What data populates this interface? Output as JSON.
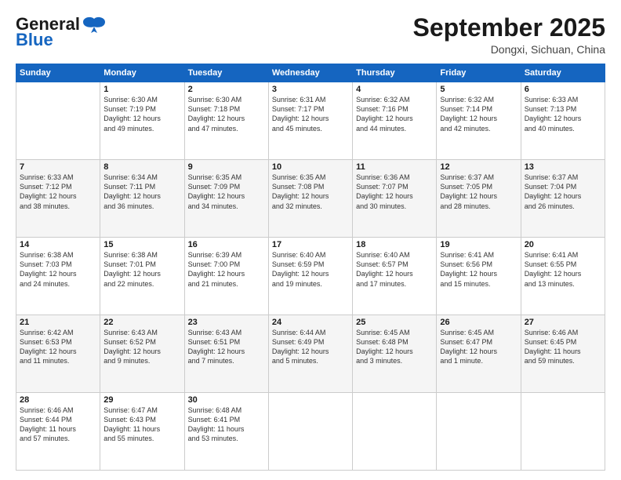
{
  "header": {
    "logo_general": "General",
    "logo_blue": "Blue",
    "month_title": "September 2025",
    "location": "Dongxi, Sichuan, China"
  },
  "weekdays": [
    "Sunday",
    "Monday",
    "Tuesday",
    "Wednesday",
    "Thursday",
    "Friday",
    "Saturday"
  ],
  "weeks": [
    [
      {
        "day": "",
        "info": ""
      },
      {
        "day": "1",
        "info": "Sunrise: 6:30 AM\nSunset: 7:19 PM\nDaylight: 12 hours\nand 49 minutes."
      },
      {
        "day": "2",
        "info": "Sunrise: 6:30 AM\nSunset: 7:18 PM\nDaylight: 12 hours\nand 47 minutes."
      },
      {
        "day": "3",
        "info": "Sunrise: 6:31 AM\nSunset: 7:17 PM\nDaylight: 12 hours\nand 45 minutes."
      },
      {
        "day": "4",
        "info": "Sunrise: 6:32 AM\nSunset: 7:16 PM\nDaylight: 12 hours\nand 44 minutes."
      },
      {
        "day": "5",
        "info": "Sunrise: 6:32 AM\nSunset: 7:14 PM\nDaylight: 12 hours\nand 42 minutes."
      },
      {
        "day": "6",
        "info": "Sunrise: 6:33 AM\nSunset: 7:13 PM\nDaylight: 12 hours\nand 40 minutes."
      }
    ],
    [
      {
        "day": "7",
        "info": "Sunrise: 6:33 AM\nSunset: 7:12 PM\nDaylight: 12 hours\nand 38 minutes."
      },
      {
        "day": "8",
        "info": "Sunrise: 6:34 AM\nSunset: 7:11 PM\nDaylight: 12 hours\nand 36 minutes."
      },
      {
        "day": "9",
        "info": "Sunrise: 6:35 AM\nSunset: 7:09 PM\nDaylight: 12 hours\nand 34 minutes."
      },
      {
        "day": "10",
        "info": "Sunrise: 6:35 AM\nSunset: 7:08 PM\nDaylight: 12 hours\nand 32 minutes."
      },
      {
        "day": "11",
        "info": "Sunrise: 6:36 AM\nSunset: 7:07 PM\nDaylight: 12 hours\nand 30 minutes."
      },
      {
        "day": "12",
        "info": "Sunrise: 6:37 AM\nSunset: 7:05 PM\nDaylight: 12 hours\nand 28 minutes."
      },
      {
        "day": "13",
        "info": "Sunrise: 6:37 AM\nSunset: 7:04 PM\nDaylight: 12 hours\nand 26 minutes."
      }
    ],
    [
      {
        "day": "14",
        "info": "Sunrise: 6:38 AM\nSunset: 7:03 PM\nDaylight: 12 hours\nand 24 minutes."
      },
      {
        "day": "15",
        "info": "Sunrise: 6:38 AM\nSunset: 7:01 PM\nDaylight: 12 hours\nand 22 minutes."
      },
      {
        "day": "16",
        "info": "Sunrise: 6:39 AM\nSunset: 7:00 PM\nDaylight: 12 hours\nand 21 minutes."
      },
      {
        "day": "17",
        "info": "Sunrise: 6:40 AM\nSunset: 6:59 PM\nDaylight: 12 hours\nand 19 minutes."
      },
      {
        "day": "18",
        "info": "Sunrise: 6:40 AM\nSunset: 6:57 PM\nDaylight: 12 hours\nand 17 minutes."
      },
      {
        "day": "19",
        "info": "Sunrise: 6:41 AM\nSunset: 6:56 PM\nDaylight: 12 hours\nand 15 minutes."
      },
      {
        "day": "20",
        "info": "Sunrise: 6:41 AM\nSunset: 6:55 PM\nDaylight: 12 hours\nand 13 minutes."
      }
    ],
    [
      {
        "day": "21",
        "info": "Sunrise: 6:42 AM\nSunset: 6:53 PM\nDaylight: 12 hours\nand 11 minutes."
      },
      {
        "day": "22",
        "info": "Sunrise: 6:43 AM\nSunset: 6:52 PM\nDaylight: 12 hours\nand 9 minutes."
      },
      {
        "day": "23",
        "info": "Sunrise: 6:43 AM\nSunset: 6:51 PM\nDaylight: 12 hours\nand 7 minutes."
      },
      {
        "day": "24",
        "info": "Sunrise: 6:44 AM\nSunset: 6:49 PM\nDaylight: 12 hours\nand 5 minutes."
      },
      {
        "day": "25",
        "info": "Sunrise: 6:45 AM\nSunset: 6:48 PM\nDaylight: 12 hours\nand 3 minutes."
      },
      {
        "day": "26",
        "info": "Sunrise: 6:45 AM\nSunset: 6:47 PM\nDaylight: 12 hours\nand 1 minute."
      },
      {
        "day": "27",
        "info": "Sunrise: 6:46 AM\nSunset: 6:45 PM\nDaylight: 11 hours\nand 59 minutes."
      }
    ],
    [
      {
        "day": "28",
        "info": "Sunrise: 6:46 AM\nSunset: 6:44 PM\nDaylight: 11 hours\nand 57 minutes."
      },
      {
        "day": "29",
        "info": "Sunrise: 6:47 AM\nSunset: 6:43 PM\nDaylight: 11 hours\nand 55 minutes."
      },
      {
        "day": "30",
        "info": "Sunrise: 6:48 AM\nSunset: 6:41 PM\nDaylight: 11 hours\nand 53 minutes."
      },
      {
        "day": "",
        "info": ""
      },
      {
        "day": "",
        "info": ""
      },
      {
        "day": "",
        "info": ""
      },
      {
        "day": "",
        "info": ""
      }
    ]
  ]
}
